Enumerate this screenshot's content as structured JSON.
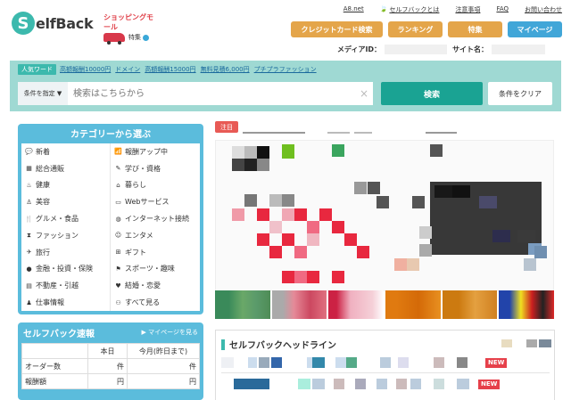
{
  "header": {
    "logo_text": "elfBack",
    "logo_letter": "S",
    "shop_title": "ショッピングモール",
    "shop_feature": "特集",
    "top_links": [
      "A8.net",
      "セルフバックとは",
      "注意事項",
      "FAQ",
      "お問い合わせ"
    ],
    "nav_buttons": [
      "クレジットカード検索",
      "ランキング",
      "特集",
      "マイページ"
    ],
    "media_id_label": "メディアID：",
    "site_name_label": "サイト名："
  },
  "search": {
    "popular_label": "人気ワード",
    "popular_tags": [
      "高額報酬10000円",
      "ドメイン",
      "高額報酬15000円",
      "無料見積6,000円",
      "プチプラファッション"
    ],
    "condition_label": "条件を指定 ▼",
    "placeholder": "検索はこちらから",
    "clear_icon": "×",
    "search_button": "検索",
    "clear_button": "条件をクリア"
  },
  "categories": {
    "title": "カテゴリーから選ぶ",
    "items": [
      {
        "icon": "💬",
        "label": "新着"
      },
      {
        "icon": "📶",
        "label": "報酬アップ中"
      },
      {
        "icon": "▦",
        "label": "総合通販"
      },
      {
        "icon": "✎",
        "label": "学び・資格"
      },
      {
        "icon": "♨",
        "label": "健康"
      },
      {
        "icon": "⌂",
        "label": "暮らし"
      },
      {
        "icon": "♙",
        "label": "美容"
      },
      {
        "icon": "▭",
        "label": "Webサービス"
      },
      {
        "icon": "🍴",
        "label": "グルメ・食品"
      },
      {
        "icon": "◍",
        "label": "インターネット接続"
      },
      {
        "icon": "⧗",
        "label": "ファッション"
      },
      {
        "icon": "☺",
        "label": "エンタメ"
      },
      {
        "icon": "✈",
        "label": "旅行"
      },
      {
        "icon": "⊞",
        "label": "ギフト"
      },
      {
        "icon": "●",
        "label": "金融・投資・保険"
      },
      {
        "icon": "⚑",
        "label": "スポーツ・趣味"
      },
      {
        "icon": "▤",
        "label": "不動産・引越"
      },
      {
        "icon": "♥",
        "label": "結婚・恋愛"
      },
      {
        "icon": "♟",
        "label": "仕事情報"
      },
      {
        "icon": "⚇",
        "label": "すべて見る"
      }
    ]
  },
  "report": {
    "title": "セルフバック速報",
    "link": "▶ マイページを見る",
    "col_today": "本日",
    "col_month": "今月(昨日まで)",
    "rows": [
      {
        "label": "オーダー数",
        "unit_today": "件",
        "unit_month": "件"
      },
      {
        "label": "報酬額",
        "unit_today": "円",
        "unit_month": "円"
      }
    ]
  },
  "notice": {
    "tag": "注目"
  },
  "headline": {
    "title": "セルフバックヘッドライン",
    "new_badges": [
      "NEW",
      "NEW"
    ]
  },
  "colors": {
    "teal": "#3cb9ad",
    "orange": "#e4a54a",
    "blue": "#41a6d8",
    "sky": "#5bbcdc",
    "search_bg": "#9fd9d3"
  }
}
